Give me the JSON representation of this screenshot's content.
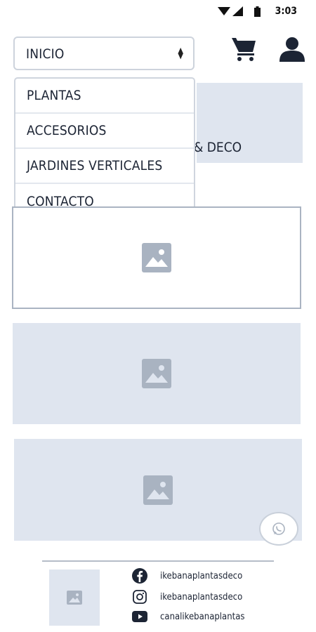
{
  "status_bar": {
    "time": "3:03"
  },
  "nav": {
    "selected": "INICIO",
    "options": [
      "PLANTAS",
      "ACCESORIOS",
      "JARDINES VERTICALES",
      "CONTACTO"
    ]
  },
  "banner": {
    "partial_text": "& DECO"
  },
  "footer": {
    "social": [
      {
        "icon": "facebook-icon",
        "handle": "ikebanaplantasdeco"
      },
      {
        "icon": "instagram-icon",
        "handle": "ikebanaplantasdeco"
      },
      {
        "icon": "youtube-icon",
        "handle": "canalikebanaplantas"
      }
    ]
  },
  "colors": {
    "placeholder_bg": "#dfe5ef",
    "placeholder_icon": "#a9b3c1",
    "text": "#1c2434"
  }
}
